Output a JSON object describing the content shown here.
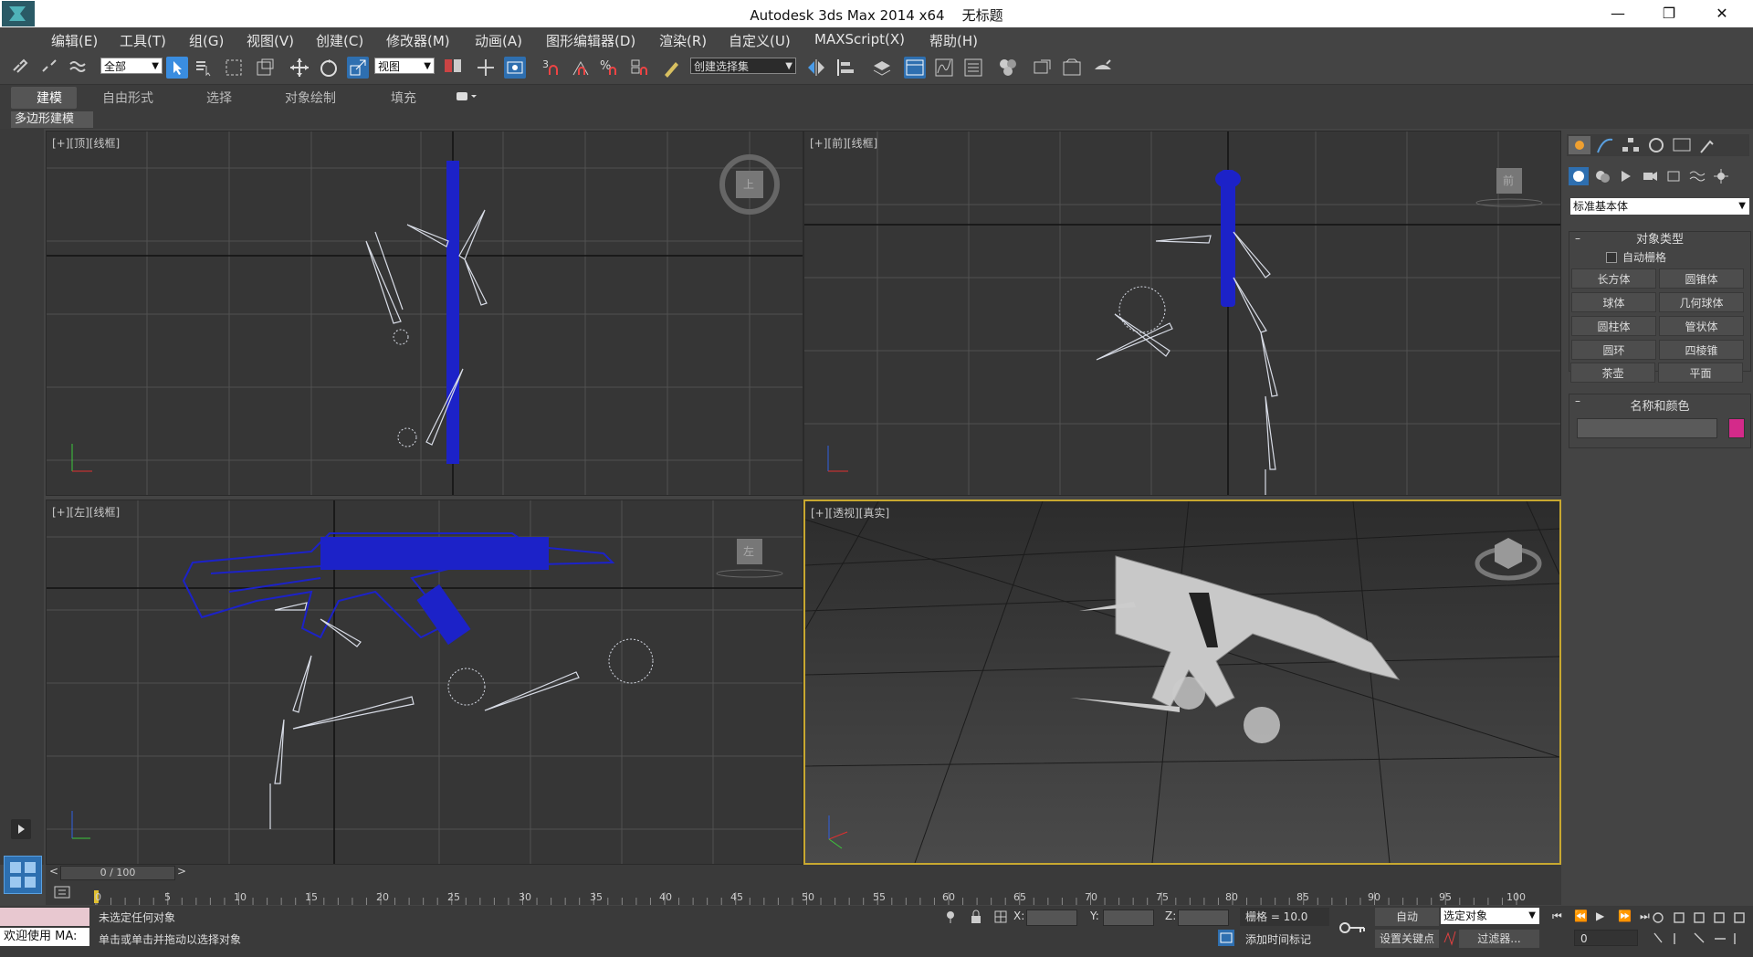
{
  "titlebar": {
    "app": "Autodesk 3ds Max  2014 x64",
    "document": "无标题"
  },
  "menu": [
    "编辑(E)",
    "工具(T)",
    "组(G)",
    "视图(V)",
    "创建(C)",
    "修改器(M)",
    "动画(A)",
    "图形编辑器(D)",
    "渲染(R)",
    "自定义(U)",
    "MAXScript(X)",
    "帮助(H)"
  ],
  "toolbar": {
    "filter_value": "全部",
    "refcoord_value": "视图",
    "selset_placeholder": "创建选择集"
  },
  "ribbon": {
    "tabs": [
      "建模",
      "自由形式",
      "选择",
      "对象绘制",
      "填充"
    ],
    "subtab": "多边形建模"
  },
  "viewports": [
    {
      "label": "[+][顶][线框]",
      "cube": "上"
    },
    {
      "label": "[+][前][线框]",
      "cube": "前"
    },
    {
      "label": "[+][左][线框]",
      "cube": "左"
    },
    {
      "label": "[+][透视][真实]",
      "cube": ""
    }
  ],
  "command_panel": {
    "category": "标准基本体",
    "rollout_object_type": "对象类型",
    "autogrid": "自动栅格",
    "buttons": [
      "长方体",
      "圆锥体",
      "球体",
      "几何球体",
      "圆柱体",
      "管状体",
      "圆环",
      "四棱锥",
      "茶壶",
      "平面"
    ],
    "rollout_name_color": "名称和颜色",
    "object_color": "#d42a8a"
  },
  "timeline": {
    "frame_label": "0 / 100",
    "ticks": [
      "0",
      "5",
      "10",
      "15",
      "20",
      "25",
      "30",
      "35",
      "40",
      "45",
      "50",
      "55",
      "60",
      "65",
      "70",
      "75",
      "80",
      "85",
      "90",
      "95",
      "100"
    ]
  },
  "status": {
    "welcome": "欢迎使用 MA:",
    "selection_msg": "未选定任何对象",
    "prompt": "单击或单击并拖动以选择对象",
    "x_label": "X:",
    "y_label": "Y:",
    "z_label": "Z:",
    "grid": "栅格 = 10.0",
    "add_time_tag": "添加时间标记",
    "auto_key": "自动",
    "key_mode_value": "选定对象",
    "set_key": "设置关键点",
    "filters": "过滤器...",
    "frame_value": "0"
  },
  "colors": {
    "selected_wire": "#1c22c8",
    "wire": "#d8dce6",
    "accent": "#3a8de0",
    "active_border": "#c8a830"
  }
}
